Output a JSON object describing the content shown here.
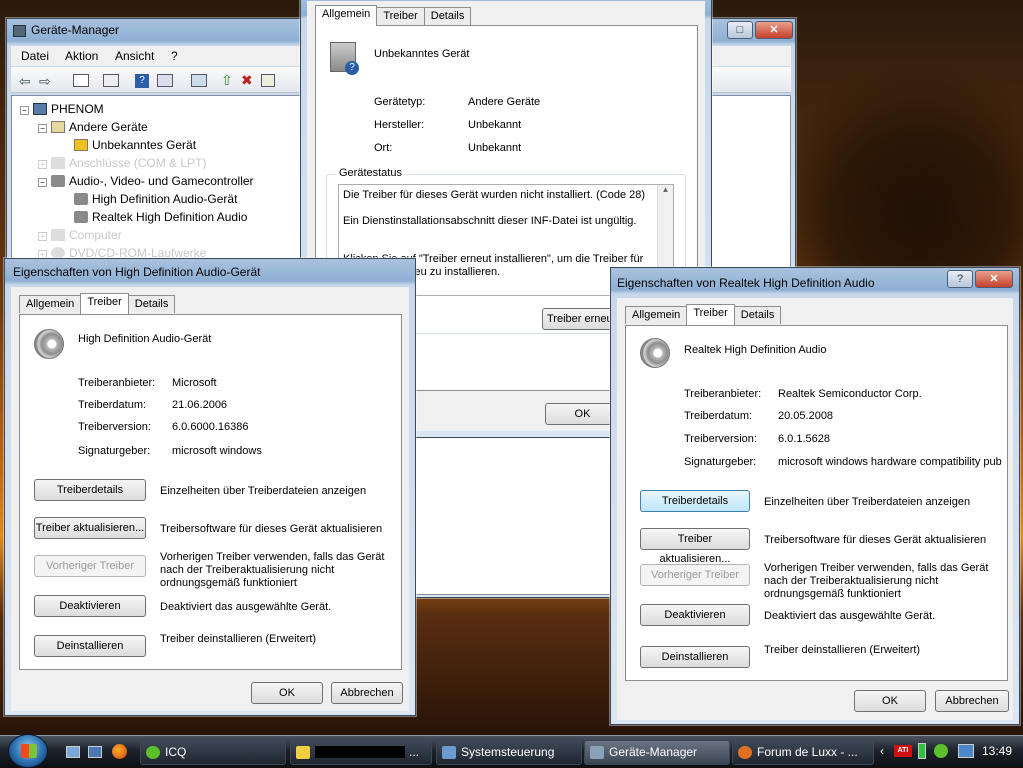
{
  "colors": {
    "accent": "#3c7fb1",
    "error_yellow": "#f0c020",
    "title_blue": "#a9c2de"
  },
  "devmgr": {
    "title": "Geräte-Manager",
    "menu": [
      "Datei",
      "Aktion",
      "Ansicht",
      "?"
    ],
    "tree": [
      {
        "label": "PHENOM",
        "icon": "computer-icon"
      },
      {
        "label": "Andere Geräte",
        "icon": "unknown-device-icon"
      },
      {
        "label": "Unbekanntes Gerät",
        "icon": "warning-device-icon"
      },
      {
        "label": "Anschlüsse (COM & LPT)",
        "icon": "port-icon"
      },
      {
        "label": "Audio-, Video- und Gamecontroller",
        "icon": "speaker-icon"
      },
      {
        "label": "High Definition Audio-Gerät",
        "icon": "speaker-icon"
      },
      {
        "label": "Realtek High Definition Audio",
        "icon": "speaker-icon"
      },
      {
        "label": "Computer",
        "icon": "computer-icon"
      },
      {
        "label": "DVD/CD-ROM-Laufwerke",
        "icon": "disc-icon"
      }
    ]
  },
  "unknown": {
    "tabs": [
      "Allgemein",
      "Treiber",
      "Details"
    ],
    "device_name": "Unbekanntes Gerät",
    "rows": [
      {
        "k": "Gerätetyp:",
        "v": "Andere Geräte"
      },
      {
        "k": "Hersteller:",
        "v": "Unbekannt"
      },
      {
        "k": "Ort:",
        "v": "Unbekannt"
      }
    ],
    "status_title": "Gerätestatus",
    "status_lines": [
      "Die Treiber für dieses Gerät wurden nicht installiert. (Code 28)",
      "Ein Dienstinstallationsabschnitt dieser INF-Datei ist ungültig.",
      "Klicken Sie auf \"Treiber erneut installieren\", um die Treiber für",
      "dieses Gerät neu zu installieren."
    ],
    "reinstall": "Treiber erneut",
    "ok": "OK"
  },
  "hd": {
    "title": "Eigenschaften von High Definition Audio-Gerät",
    "tabs": [
      "Allgemein",
      "Treiber",
      "Details"
    ],
    "device_name": "High Definition Audio-Gerät",
    "rows": [
      {
        "k": "Treiberanbieter:",
        "v": "Microsoft"
      },
      {
        "k": "Treiberdatum:",
        "v": "21.06.2006"
      },
      {
        "k": "Treiberversion:",
        "v": "6.0.6000.16386"
      },
      {
        "k": "Signaturgeber:",
        "v": "microsoft windows"
      }
    ],
    "actions": [
      {
        "btn": "Treiberdetails",
        "desc": "Einzelheiten über Treiberdateien anzeigen",
        "disabled": false
      },
      {
        "btn": "Treiber aktualisieren...",
        "desc": "Treibersoftware für dieses Gerät aktualisieren",
        "disabled": false
      },
      {
        "btn": "Vorheriger Treiber",
        "desc": "Vorherigen Treiber verwenden, falls das Gerät nach der Treiberaktualisierung nicht ordnungsgemäß funktioniert",
        "disabled": true
      },
      {
        "btn": "Deaktivieren",
        "desc": "Deaktiviert das ausgewählte Gerät.",
        "disabled": false
      },
      {
        "btn": "Deinstallieren",
        "desc": "Treiber deinstallieren (Erweitert)",
        "disabled": false
      }
    ],
    "ok": "OK",
    "cancel": "Abbrechen"
  },
  "rt": {
    "title": "Eigenschaften von Realtek High Definition Audio",
    "tabs": [
      "Allgemein",
      "Treiber",
      "Details"
    ],
    "device_name": "Realtek High Definition Audio",
    "rows": [
      {
        "k": "Treiberanbieter:",
        "v": "Realtek Semiconductor Corp."
      },
      {
        "k": "Treiberdatum:",
        "v": "20.05.2008"
      },
      {
        "k": "Treiberversion:",
        "v": "6.0.1.5628"
      },
      {
        "k": "Signaturgeber:",
        "v": "microsoft windows hardware compatibility publisl"
      }
    ],
    "actions": [
      {
        "btn": "Treiberdetails",
        "desc": "Einzelheiten über Treiberdateien anzeigen",
        "disabled": false
      },
      {
        "btn": "Treiber aktualisieren...",
        "desc": "Treibersoftware für dieses Gerät aktualisieren",
        "disabled": false
      },
      {
        "btn": "Vorheriger Treiber",
        "desc": "Vorherigen Treiber verwenden, falls das Gerät nach der Treiberaktualisierung nicht ordnungsgemäß funktioniert",
        "disabled": true
      },
      {
        "btn": "Deaktivieren",
        "desc": "Deaktiviert das ausgewählte Gerät.",
        "disabled": false
      },
      {
        "btn": "Deinstallieren",
        "desc": "Treiber deinstallieren (Erweitert)",
        "disabled": false
      }
    ],
    "ok": "OK",
    "cancel": "Abbrechen"
  },
  "taskbar": {
    "items": [
      {
        "label": "ICQ"
      },
      {
        "label": "..."
      },
      {
        "label": "Systemsteuerung"
      },
      {
        "label": "Geräte-Manager"
      },
      {
        "label": "Forum de Luxx - ..."
      }
    ],
    "clock": "13:49"
  }
}
